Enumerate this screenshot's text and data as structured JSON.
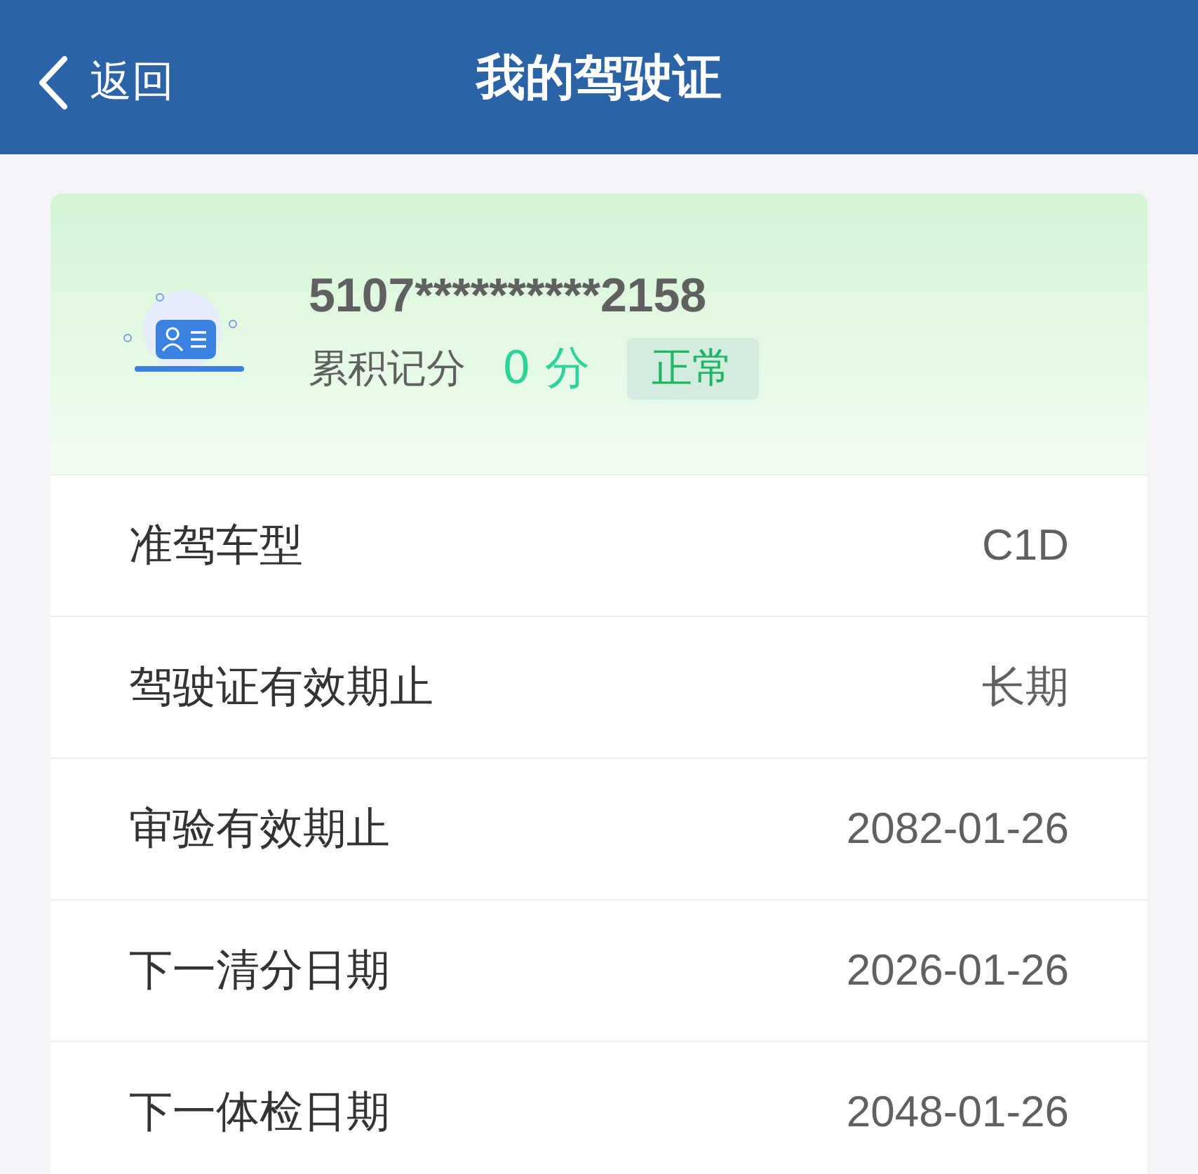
{
  "header": {
    "back": "返回",
    "title": "我的驾驶证"
  },
  "license": {
    "number": "5107**********2158",
    "points_label": "累积记分",
    "points": "0 分",
    "status": "正常"
  },
  "rows": [
    {
      "label": "准驾车型",
      "value": "C1D"
    },
    {
      "label": "驾驶证有效期止",
      "value": "长期"
    },
    {
      "label": "审验有效期止",
      "value": "2082-01-26"
    },
    {
      "label": "下一清分日期",
      "value": "2026-01-26"
    },
    {
      "label": "下一体检日期",
      "value": "2048-01-26"
    }
  ]
}
